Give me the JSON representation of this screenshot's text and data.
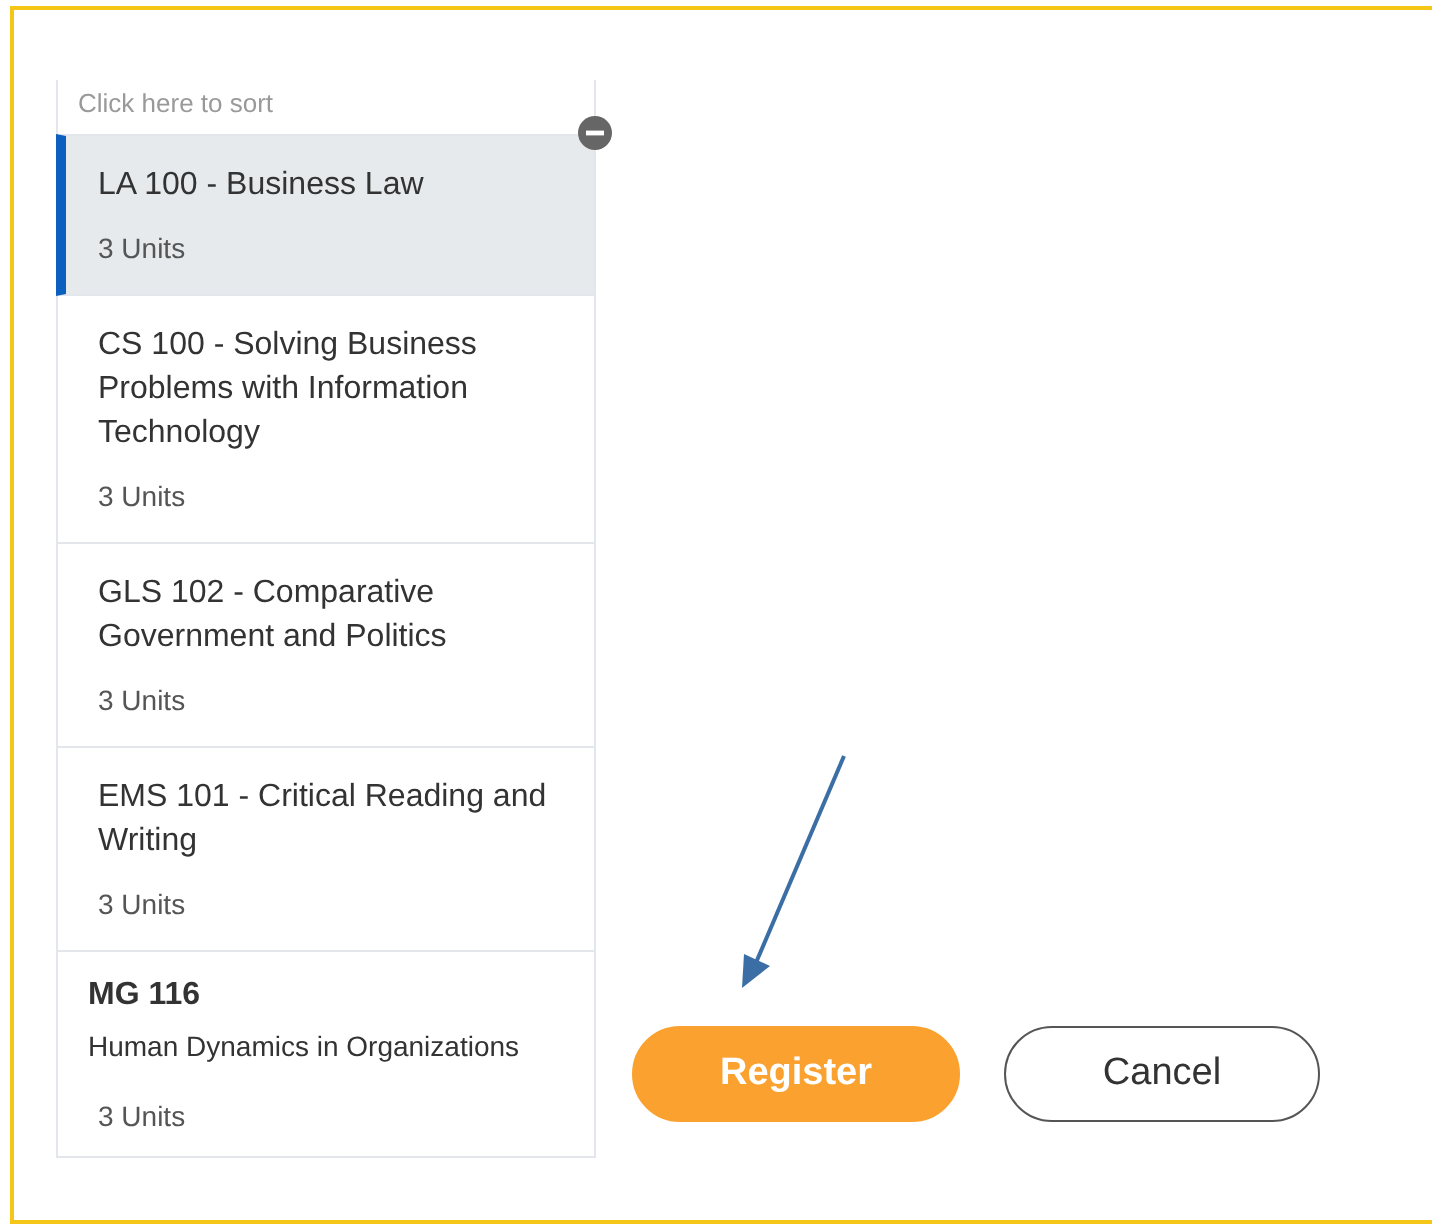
{
  "sort_hint": "Click here to sort",
  "courses": [
    {
      "kind": "course",
      "title": "LA 100 - Business Law",
      "units": "3 Units",
      "selected": true
    },
    {
      "kind": "course",
      "title": "CS 100 - Solving Business Problems with Information Technology",
      "units": "3 Units",
      "selected": false
    },
    {
      "kind": "course",
      "title": "GLS 102 - Comparative Government and Politics",
      "units": "3 Units",
      "selected": false
    },
    {
      "kind": "course",
      "title": "EMS 101 - Critical Reading and Writing",
      "units": "3 Units",
      "selected": false
    },
    {
      "kind": "split",
      "title": "MG 116",
      "subtitle": "Human Dynamics in Organizations",
      "units": "3 Units",
      "selected": false
    }
  ],
  "buttons": [
    {
      "kind": "primary",
      "label": "Register"
    },
    {
      "kind": "secondary",
      "label": "Cancel"
    }
  ]
}
